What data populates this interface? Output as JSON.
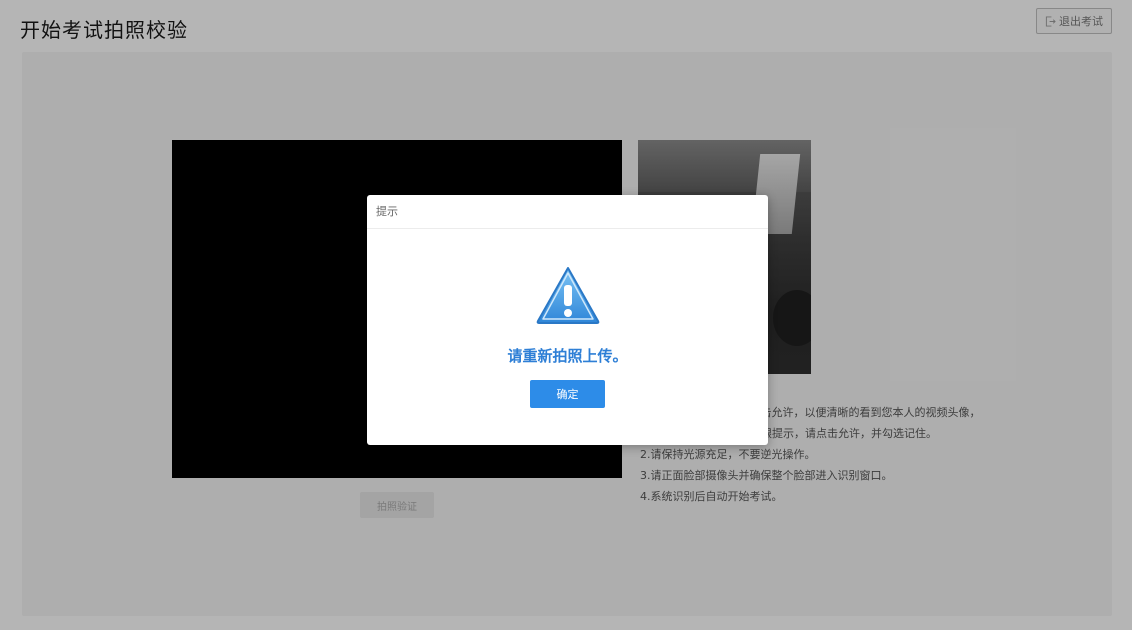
{
  "header": {
    "title": "开始考试拍照校验",
    "exit_label": "退出考试",
    "exit_icon": "logout-icon"
  },
  "camera": {
    "photo_button_label": "拍照验证"
  },
  "instructions": [
    "1.请您在浏览器弹窗中点击允许，以便清晰的看到您本人的视频头像，",
    "如您的浏览器有摄像头权限提示，请点击允许，并勾选记住。",
    "2.请保持光源充足，不要逆光操作。",
    "3.请正面脸部摄像头并确保整个脸部进入识别窗口。",
    "4.系统识别后自动开始考试。"
  ],
  "modal": {
    "title": "提示",
    "icon": "warning-icon",
    "message": "请重新拍照上传。",
    "confirm_label": "确定"
  },
  "colors": {
    "accent": "#2d8ce8",
    "message": "#2e7fd6",
    "overlay": "rgba(0,0,0,0.28)"
  }
}
